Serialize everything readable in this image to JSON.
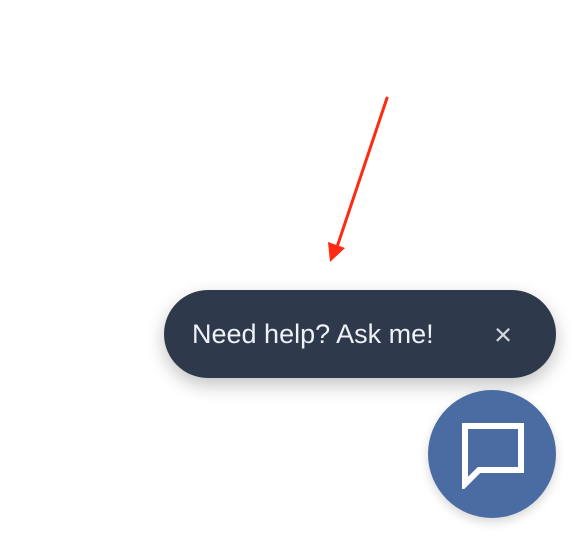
{
  "help_prompt": {
    "message": "Need help? Ask me!",
    "close_symbol": "×"
  },
  "chat_launcher": {
    "icon": "chat-bubble-icon"
  },
  "annotation": {
    "icon": "red-arrow-icon"
  },
  "colors": {
    "page_background": "#ffffff",
    "tooltip_background": "#2f394c",
    "tooltip_text": "#eef1f6",
    "close_icon": "#d4d7dd",
    "launcher_background": "#4b6ca3",
    "launcher_icon": "#ffffff",
    "arrow": "#ff2a12"
  }
}
